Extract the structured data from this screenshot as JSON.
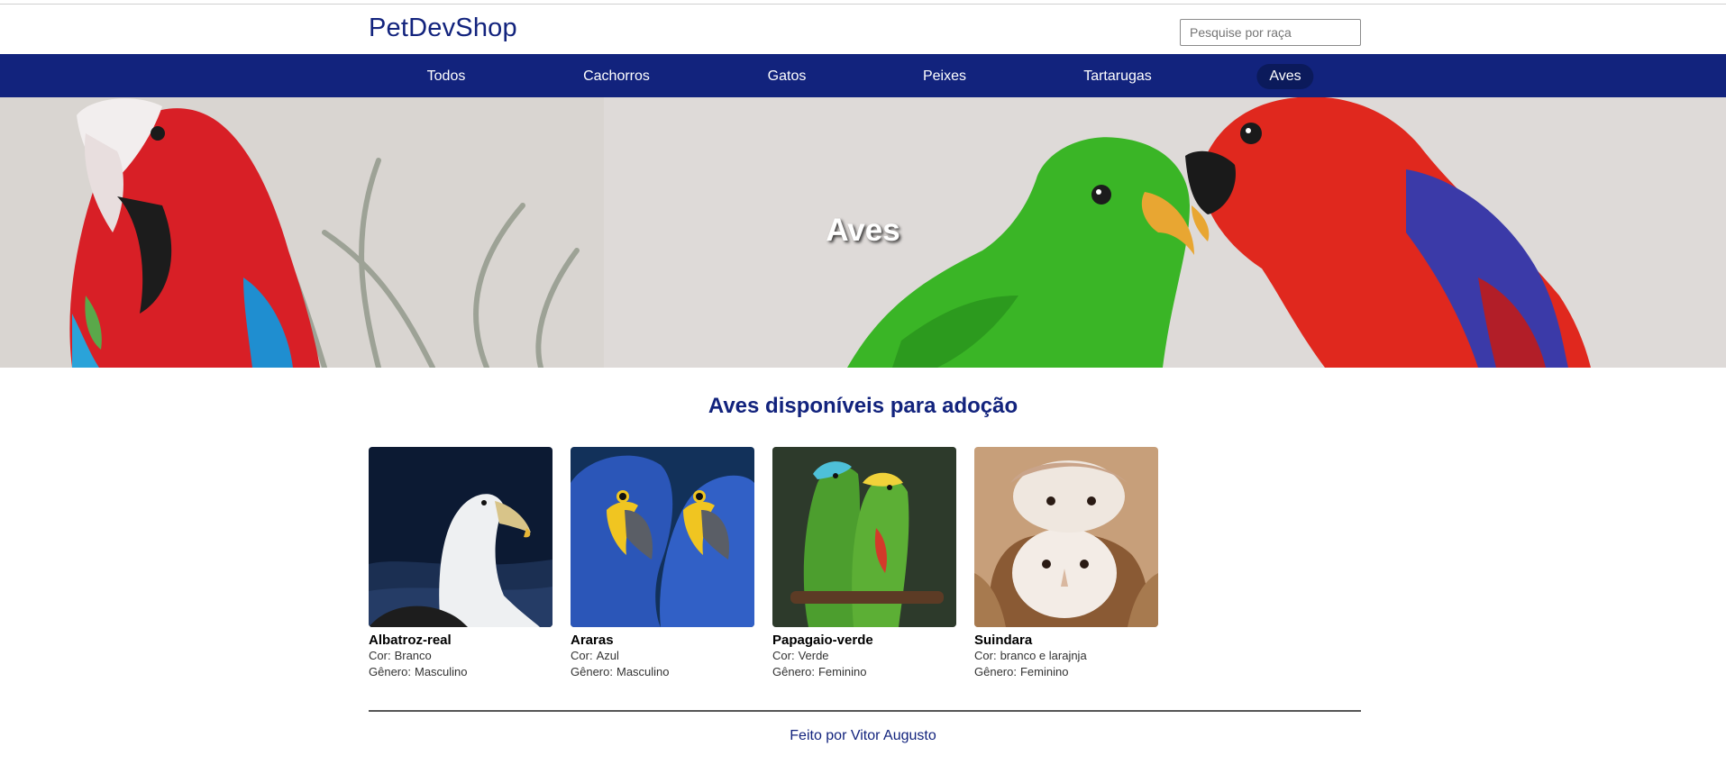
{
  "header": {
    "logo": "PetDevShop",
    "search_placeholder": "Pesquise por raça"
  },
  "nav": {
    "items": [
      {
        "label": "Todos",
        "active": false
      },
      {
        "label": "Cachorros",
        "active": false
      },
      {
        "label": "Gatos",
        "active": false
      },
      {
        "label": "Peixes",
        "active": false
      },
      {
        "label": "Tartarugas",
        "active": false
      },
      {
        "label": "Aves",
        "active": true
      }
    ]
  },
  "hero": {
    "title": "Aves"
  },
  "main": {
    "section_title": "Aves disponíveis para adoção",
    "field_labels": {
      "color": "Cor:",
      "gender": "Gênero:"
    },
    "pets": [
      {
        "name": "Albatroz-real",
        "color": "Branco",
        "gender": "Masculino"
      },
      {
        "name": "Araras",
        "color": "Azul",
        "gender": "Masculino"
      },
      {
        "name": "Papagaio-verde",
        "color": "Verde",
        "gender": "Feminino"
      },
      {
        "name": "Suindara",
        "color": "branco e larajnja",
        "gender": "Feminino"
      }
    ]
  },
  "footer": {
    "text": "Feito por Vitor Augusto"
  },
  "colors": {
    "brand": "#12237d",
    "nav_active": "#0b1a5b"
  }
}
